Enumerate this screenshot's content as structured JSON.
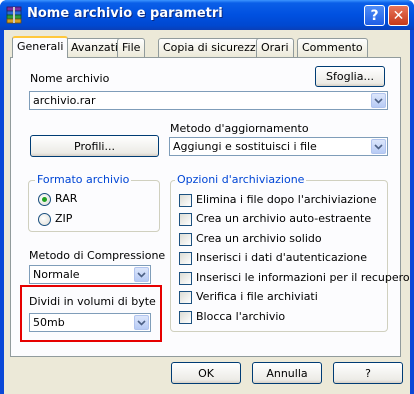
{
  "window": {
    "title": "Nome archivio e parametri",
    "help_glyph": "?",
    "close_glyph": "✕"
  },
  "tabs": [
    "Generali",
    "Avanzati",
    "File",
    "Copia di sicurezza",
    "Orari",
    "Commento"
  ],
  "archive_name": {
    "label": "Nome archivio",
    "value": "archivio.rar",
    "browse_button": "Sfoglia..."
  },
  "profiles_button": "Profili...",
  "update_method": {
    "label": "Metodo d'aggiornamento",
    "value": "Aggiungi e sostituisci i file"
  },
  "archive_format": {
    "title": "Formato archivio",
    "options": [
      "RAR",
      "ZIP"
    ],
    "selected": "RAR"
  },
  "compression": {
    "label": "Metodo di Compressione",
    "value": "Normale"
  },
  "split_volumes": {
    "label": "Dividi in volumi di byte",
    "value": "50mb"
  },
  "archive_options": {
    "title": "Opzioni d'archiviazione",
    "items": [
      {
        "label": "Elimina i file dopo l'archiviazione",
        "checked": false
      },
      {
        "label": "Crea un archivio auto-estraente",
        "checked": false
      },
      {
        "label": "Crea un archivio solido",
        "checked": false
      },
      {
        "label": "Inserisci i dati d'autenticazione",
        "checked": false
      },
      {
        "label": "Inserisci le informazioni per il recupero",
        "checked": false
      },
      {
        "label": "Verifica i file archiviati",
        "checked": false
      },
      {
        "label": "Blocca l'archivio",
        "checked": false
      }
    ]
  },
  "footer": {
    "ok": "OK",
    "cancel": "Annulla",
    "help": "?"
  },
  "icons": {
    "dropdown": "chevron-down-icon",
    "app": "winrar-books-icon"
  },
  "colors": {
    "titlebar": "#0050e0",
    "highlight": "#e60000",
    "group_title": "#0046d5"
  }
}
